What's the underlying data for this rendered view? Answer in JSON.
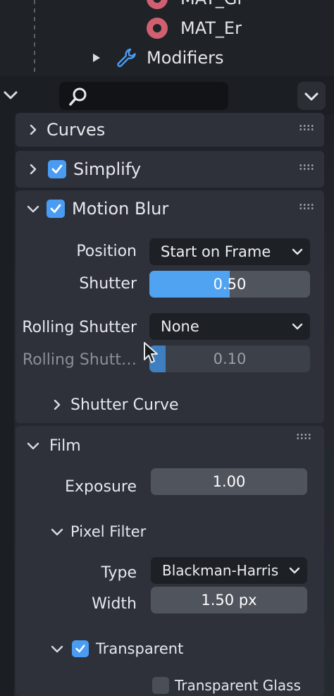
{
  "outliner": {
    "partial_label": "MAT_Gr",
    "mat_label": "MAT_Er",
    "modifiers_label": "Modifiers"
  },
  "header": {
    "search_placeholder": ""
  },
  "panels": {
    "curves": "Curves",
    "simplify": "Simplify",
    "motion_blur": "Motion Blur"
  },
  "motion_blur": {
    "position_label": "Position",
    "position_value": "Start on Frame",
    "shutter_label": "Shutter",
    "shutter_value": "0.50",
    "shutter_fill": 0.5,
    "rolling_shutter_label": "Rolling Shutter",
    "rolling_shutter_value": "None",
    "rolling_shutter_duration_label": "Rolling Shutt…",
    "rolling_shutter_duration_value": "0.10",
    "rolling_shutter_duration_fill": 0.1,
    "shutter_curve_label": "Shutter Curve"
  },
  "film": {
    "title": "Film",
    "exposure_label": "Exposure",
    "exposure_value": "1.00",
    "pixel_filter_label": "Pixel Filter",
    "type_label": "Type",
    "type_value": "Blackman-Harris",
    "width_label": "Width",
    "width_value": "1.50 px",
    "transparent_label": "Transparent",
    "transparent_glass_label": "Transparent Glass"
  },
  "colors": {
    "accent": "#4a9cf3",
    "panel": "#2e3139",
    "field": "#50545d",
    "dropdown": "#1d2025"
  }
}
